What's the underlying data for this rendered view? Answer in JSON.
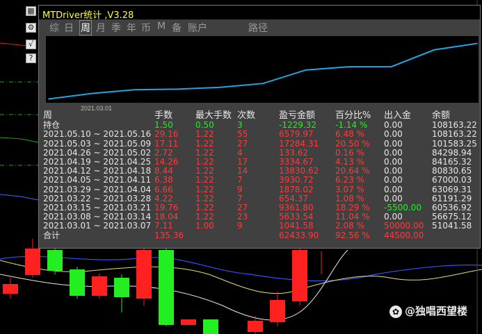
{
  "window": {
    "title": "MTDriver统计 ,V3.28"
  },
  "side_buttons": [
    {
      "icon": "drag-icon",
      "glyph": "▦"
    },
    {
      "icon": "gear-icon",
      "glyph": "⚙"
    },
    {
      "icon": "checkmark-icon",
      "glyph": "√"
    },
    {
      "icon": "help-icon",
      "glyph": "?"
    }
  ],
  "tabs": [
    {
      "label": "综",
      "active": false
    },
    {
      "label": "日",
      "active": false
    },
    {
      "label": "周",
      "active": true
    },
    {
      "label": "月",
      "active": false
    },
    {
      "label": "季",
      "active": false
    },
    {
      "label": "年",
      "active": false
    },
    {
      "label": "币",
      "active": false
    },
    {
      "label": "M",
      "active": false
    },
    {
      "label": "备",
      "active": false
    },
    {
      "label": "账户",
      "active": false
    },
    {
      "label": "路径",
      "active": false
    }
  ],
  "chart_data": {
    "type": "line",
    "x_tick_label": "2021.03.01",
    "x": [
      "2021.03.01",
      "2021.03.08",
      "2021.03.15",
      "2021.03.22",
      "2021.03.29",
      "2021.04.05",
      "2021.04.12",
      "2021.04.19",
      "2021.04.26",
      "2021.05.03",
      "2021.05.10"
    ],
    "values": [
      51041.58,
      56675.12,
      60536.92,
      61191.29,
      63069.31,
      67000.03,
      80830.65,
      84165.32,
      84298.94,
      101583.25,
      108163.22
    ],
    "ylim": [
      50000,
      110000
    ],
    "line_color": "#1ea7e6"
  },
  "table": {
    "headers": [
      "周",
      "手数",
      "最大手数",
      "次数",
      "盈亏金额",
      "百分比%",
      "出入金",
      "余额"
    ],
    "holding": {
      "label": "持仓",
      "lots": "1.50",
      "max_lots": "0.50",
      "count": "3",
      "pnl": "-1229.32",
      "pct": "-1.14 %",
      "deposit": "0.00",
      "balance": "108163.22"
    },
    "rows": [
      {
        "period": "2021.05.10 ~ 2021.05.16",
        "lots": "29.16",
        "max_lots": "1.22",
        "count": "55",
        "pnl": "6579.97",
        "pct": "6.48 %",
        "deposit": "0.00",
        "balance": "108163.22"
      },
      {
        "period": "2021.05.03 ~ 2021.05.09",
        "lots": "17.11",
        "max_lots": "1.22",
        "count": "27",
        "pnl": "17284.31",
        "pct": "20.50 %",
        "deposit": "0.00",
        "balance": "101583.25"
      },
      {
        "period": "2021.04.26 ~ 2021.05.02",
        "lots": "2.72",
        "max_lots": "1.22",
        "count": "4",
        "pnl": "133.62",
        "pct": "0.16 %",
        "deposit": "0.00",
        "balance": "84298.94"
      },
      {
        "period": "2021.04.19 ~ 2021.04.25",
        "lots": "14.26",
        "max_lots": "1.22",
        "count": "17",
        "pnl": "3334.67",
        "pct": "4.13 %",
        "deposit": "0.00",
        "balance": "84165.32"
      },
      {
        "period": "2021.04.12 ~ 2021.04.18",
        "lots": "8.44",
        "max_lots": "1.22",
        "count": "14",
        "pnl": "13830.62",
        "pct": "20.64 %",
        "deposit": "0.00",
        "balance": "80830.65"
      },
      {
        "period": "2021.04.05 ~ 2021.04.11",
        "lots": "6.38",
        "max_lots": "1.22",
        "count": "7",
        "pnl": "3930.72",
        "pct": "6.23 %",
        "deposit": "0.00",
        "balance": "67000.03"
      },
      {
        "period": "2021.03.29 ~ 2021.04.04",
        "lots": "6.66",
        "max_lots": "1.22",
        "count": "9",
        "pnl": "1878.02",
        "pct": "3.07 %",
        "deposit": "0.00",
        "balance": "63069.31"
      },
      {
        "period": "2021.03.22 ~ 2021.03.28",
        "lots": "4.22",
        "max_lots": "1.22",
        "count": "7",
        "pnl": "654.37",
        "pct": "1.08 %",
        "deposit": "0.00",
        "balance": "61191.29"
      },
      {
        "period": "2021.03.15 ~ 2021.03.21",
        "lots": "19.76",
        "max_lots": "1.22",
        "count": "27",
        "pnl": "9361.80",
        "pct": "18.29 %",
        "deposit": "-5500.00",
        "balance": "60536.92"
      },
      {
        "period": "2021.03.08 ~ 2021.03.14",
        "lots": "18.04",
        "max_lots": "1.22",
        "count": "23",
        "pnl": "5633.54",
        "pct": "11.04 %",
        "deposit": "0.00",
        "balance": "56675.12"
      },
      {
        "period": "2021.03.01 ~ 2021.03.07",
        "lots": "7.11",
        "max_lots": "1.00",
        "count": "9",
        "pnl": "1041.58",
        "pct": "2.08 %",
        "deposit": "50000.00",
        "balance": "51041.58"
      }
    ],
    "total": {
      "label": "合计",
      "lots": "135.36",
      "pnl": "62433.90",
      "pct": "92.56 %",
      "deposit": "44500.00"
    }
  },
  "watermark": {
    "text": "@独唱西望楼",
    "icon": "weibo-icon"
  },
  "colors": {
    "positive": "#ff3a3a",
    "holding": "#22ee22",
    "negative_deposit": "#22ee22",
    "text": "#e8e8e8",
    "accent": "#ffff33"
  }
}
